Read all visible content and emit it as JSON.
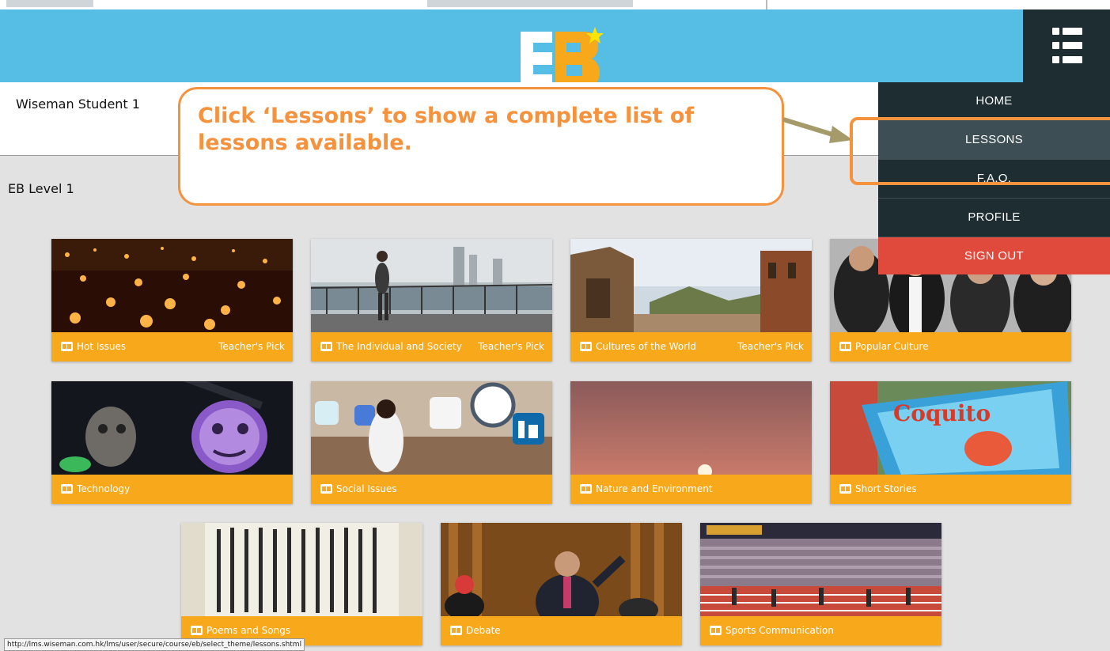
{
  "logo": {
    "text": "EB"
  },
  "user": {
    "name": "Wiseman Student 1"
  },
  "level": "EB Level 1",
  "menu": [
    {
      "label": "HOME"
    },
    {
      "label": "LESSONS",
      "active": true
    },
    {
      "label": "F.A.Q."
    },
    {
      "label": "PROFILE"
    },
    {
      "label": "SIGN OUT"
    }
  ],
  "callout": {
    "text": "Click ‘Lessons’ to show a complete list of lessons available."
  },
  "themes": [
    {
      "title": "Hot Issues",
      "pick": "Teacher's Pick"
    },
    {
      "title": "The Individual and Society",
      "pick": "Teacher's Pick"
    },
    {
      "title": "Cultures of the World",
      "pick": "Teacher's Pick"
    },
    {
      "title": "Popular Culture",
      "pick": ""
    },
    {
      "title": "Technology",
      "pick": ""
    },
    {
      "title": "Social Issues",
      "pick": ""
    },
    {
      "title": "Nature and Environment",
      "pick": ""
    },
    {
      "title": "Short Stories",
      "pick": ""
    },
    {
      "title": "Poems and Songs",
      "pick": ""
    },
    {
      "title": "Debate",
      "pick": ""
    },
    {
      "title": "Sports Communication",
      "pick": ""
    }
  ],
  "status_url": "http://lms.wiseman.com.hk/lms/user/secure/course/eb/select_theme/lessons.shtml",
  "colors": {
    "header": "#56bde4",
    "nav_dark": "#1d2d31",
    "nav_active": "#3d4f54",
    "signout": "#e04a3c",
    "caption": "#f7a81b",
    "callout": "#f5923e"
  }
}
